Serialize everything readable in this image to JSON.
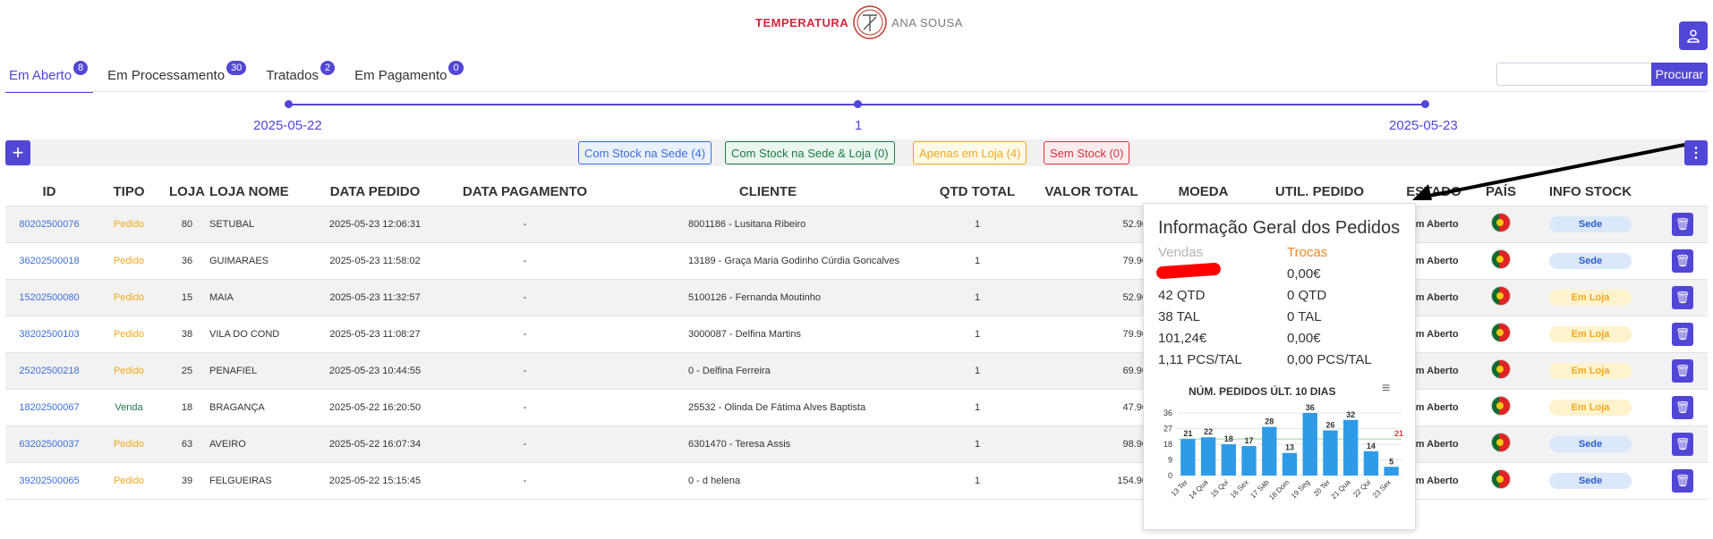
{
  "header": {
    "logo_left": "TEMPERATURA",
    "logo_right": "ANA SOUSA"
  },
  "tabs": [
    {
      "label": "Em Aberto",
      "count": "8"
    },
    {
      "label": "Em Processamento",
      "count": "30"
    },
    {
      "label": "Tratados",
      "count": "2"
    },
    {
      "label": "Em Pagamento",
      "count": "0"
    }
  ],
  "search": {
    "placeholder": "",
    "button": "Procurar"
  },
  "timeline": {
    "start": "2025-05-22",
    "middle": "1",
    "end": "2025-05-23"
  },
  "filters": {
    "sede": "Com Stock na Sede (4)",
    "sede_loja": "Com Stock na Sede & Loja (0)",
    "loja": "Apenas em Loja (4)",
    "sem": "Sem Stock (0)"
  },
  "table": {
    "headers": [
      "ID",
      "TIPO",
      "LOJA",
      "LOJA NOME",
      "DATA PEDIDO",
      "DATA PAGAMENTO",
      "CLIENTE",
      "QTD TOTAL",
      "VALOR TOTAL",
      "MOEDA",
      "UTIL. PEDIDO",
      "ESTADO",
      "PAÍS",
      "INFO STOCK"
    ],
    "rows": [
      {
        "id": "80202500076",
        "tipo": "Pedido",
        "loja": "80",
        "nome": "SETUBAL",
        "data": "2025-05-23 12:06:31",
        "pag": "-",
        "cliente": "8001186 - Lusitana Ribeiro",
        "qtd": "1",
        "valor": "52.90",
        "estado": "Em Aberto",
        "stock": "Sede"
      },
      {
        "id": "36202500018",
        "tipo": "Pedido",
        "loja": "36",
        "nome": "GUIMARAES",
        "data": "2025-05-23 11:58:02",
        "pag": "-",
        "cliente": "13189 - Graça Maria Godinho Cúrdia Goncalves",
        "qtd": "1",
        "valor": "79.90",
        "estado": "Em Aberto",
        "stock": "Sede"
      },
      {
        "id": "15202500080",
        "tipo": "Pedido",
        "loja": "15",
        "nome": "MAIA",
        "data": "2025-05-23 11:32:57",
        "pag": "-",
        "cliente": "5100126 - Fernanda Moutinho",
        "qtd": "1",
        "valor": "52.90",
        "estado": "Em Aberto",
        "stock": "Em Loja"
      },
      {
        "id": "38202500103",
        "tipo": "Pedido",
        "loja": "38",
        "nome": "VILA DO COND",
        "data": "2025-05-23 11:08:27",
        "pag": "-",
        "cliente": "3000087 - Delfina Martins",
        "qtd": "1",
        "valor": "79.90",
        "estado": "Em Aberto",
        "stock": "Em Loja"
      },
      {
        "id": "25202500218",
        "tipo": "Pedido",
        "loja": "25",
        "nome": "PENAFIEL",
        "data": "2025-05-23 10:44:55",
        "pag": "-",
        "cliente": "0 - Delfina Ferreira",
        "qtd": "1",
        "valor": "69.90",
        "estado": "Em Aberto",
        "stock": "Em Loja"
      },
      {
        "id": "18202500067",
        "tipo": "Venda",
        "loja": "18",
        "nome": "BRAGANÇA",
        "data": "2025-05-22 16:20:50",
        "pag": "-",
        "cliente": "25532 - Olinda De Fátima Alves Baptista",
        "qtd": "1",
        "valor": "47.90",
        "estado": "Em Aberto",
        "stock": "Em Loja"
      },
      {
        "id": "63202500037",
        "tipo": "Pedido",
        "loja": "63",
        "nome": "AVEIRO",
        "data": "2025-05-22 16:07:34",
        "pag": "-",
        "cliente": "6301470 - Teresa Assis",
        "qtd": "1",
        "valor": "98.90",
        "estado": "Em Aberto",
        "stock": "Sede"
      },
      {
        "id": "39202500065",
        "tipo": "Pedido",
        "loja": "39",
        "nome": "FELGUEIRAS",
        "data": "2025-05-22 15:15:45",
        "pag": "-",
        "cliente": "0 - d helena",
        "qtd": "1",
        "valor": "154.90",
        "estado": "Em Aberto",
        "stock": "Sede"
      }
    ]
  },
  "popup": {
    "title": "Informação Geral dos Pedidos",
    "col1_header": "Vendas",
    "col2_header": "Trocas",
    "col1": [
      "",
      "42 QTD",
      "38 TAL",
      "101,24€",
      "1,11 PCS/TAL"
    ],
    "col2": [
      "0,00€",
      "0 QTD",
      "0 TAL",
      "0,00€",
      "0,00 PCS/TAL"
    ]
  },
  "chart_data": {
    "type": "bar",
    "title": "NÚM. PEDIDOS ÚLT. 10 DIAS",
    "categories": [
      "13 Ter",
      "14 Qua",
      "15 Qui",
      "16 Sex",
      "17 Sáb",
      "18 Dom",
      "19 Seg",
      "20 Ter",
      "21 Qua",
      "22 Qui",
      "23 Sex"
    ],
    "values": [
      21,
      22,
      18,
      17,
      28,
      13,
      36,
      26,
      32,
      14,
      5
    ],
    "reference_line": 21,
    "yticks": [
      0,
      9,
      18,
      27,
      36
    ],
    "ylim": [
      0,
      36
    ],
    "color": "#2f9be8"
  },
  "colors": {
    "accent": "#5146d6",
    "link": "#3b6fd8",
    "pedido": "#f2a81d",
    "venda": "#1d7a47"
  }
}
